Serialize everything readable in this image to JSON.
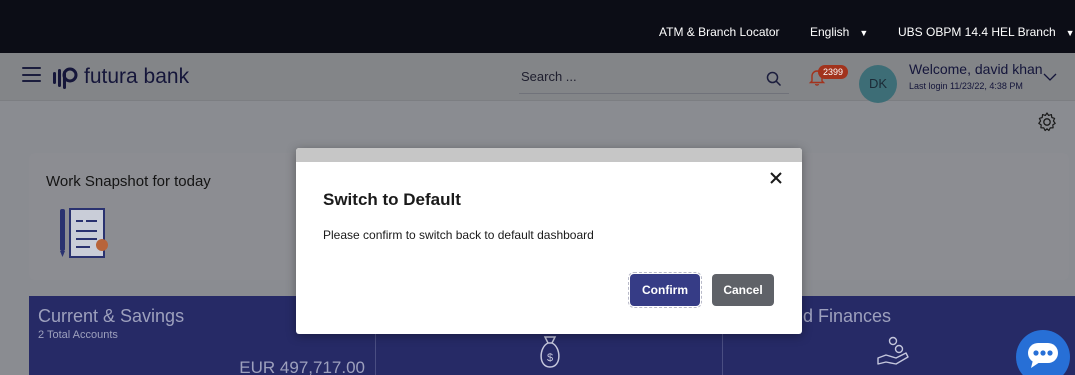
{
  "topbar": {
    "atm_locator": "ATM & Branch Locator",
    "language": "English",
    "branch": "UBS OBPM 14.4 HEL Branch"
  },
  "header": {
    "brand_name": "futura bank",
    "search_placeholder": "Search ...",
    "notification_count": "2399",
    "avatar_initials": "DK",
    "welcome_text": "Welcome, david khan",
    "last_login": "Last login 11/23/22, 4:38 PM"
  },
  "work_snapshot": {
    "title": "Work Snapshot for today"
  },
  "cards": {
    "current_savings": {
      "title": "Current & Savings",
      "subtitle": "2 Total Accounts",
      "amount": "EUR 497,717.00"
    },
    "finances_partial_title": "d Finances"
  },
  "modal": {
    "title": "Switch to Default",
    "message": "Please confirm to switch back to default dashboard",
    "confirm_label": "Confirm",
    "cancel_label": "Cancel"
  },
  "colors": {
    "topbar_bg": "#0c0d16",
    "primary_button": "#363c86",
    "secondary_button": "#5f6268",
    "card_strip": "#262a66",
    "chat_button": "#276fd6",
    "badge": "#a2331d"
  },
  "icons": [
    "menu-icon",
    "bank-logo-icon",
    "search-icon",
    "bell-icon",
    "chevron-down-icon",
    "gear-icon",
    "task-list-icon",
    "close-icon",
    "money-bag-icon",
    "hand-coins-icon",
    "chat-icon"
  ]
}
